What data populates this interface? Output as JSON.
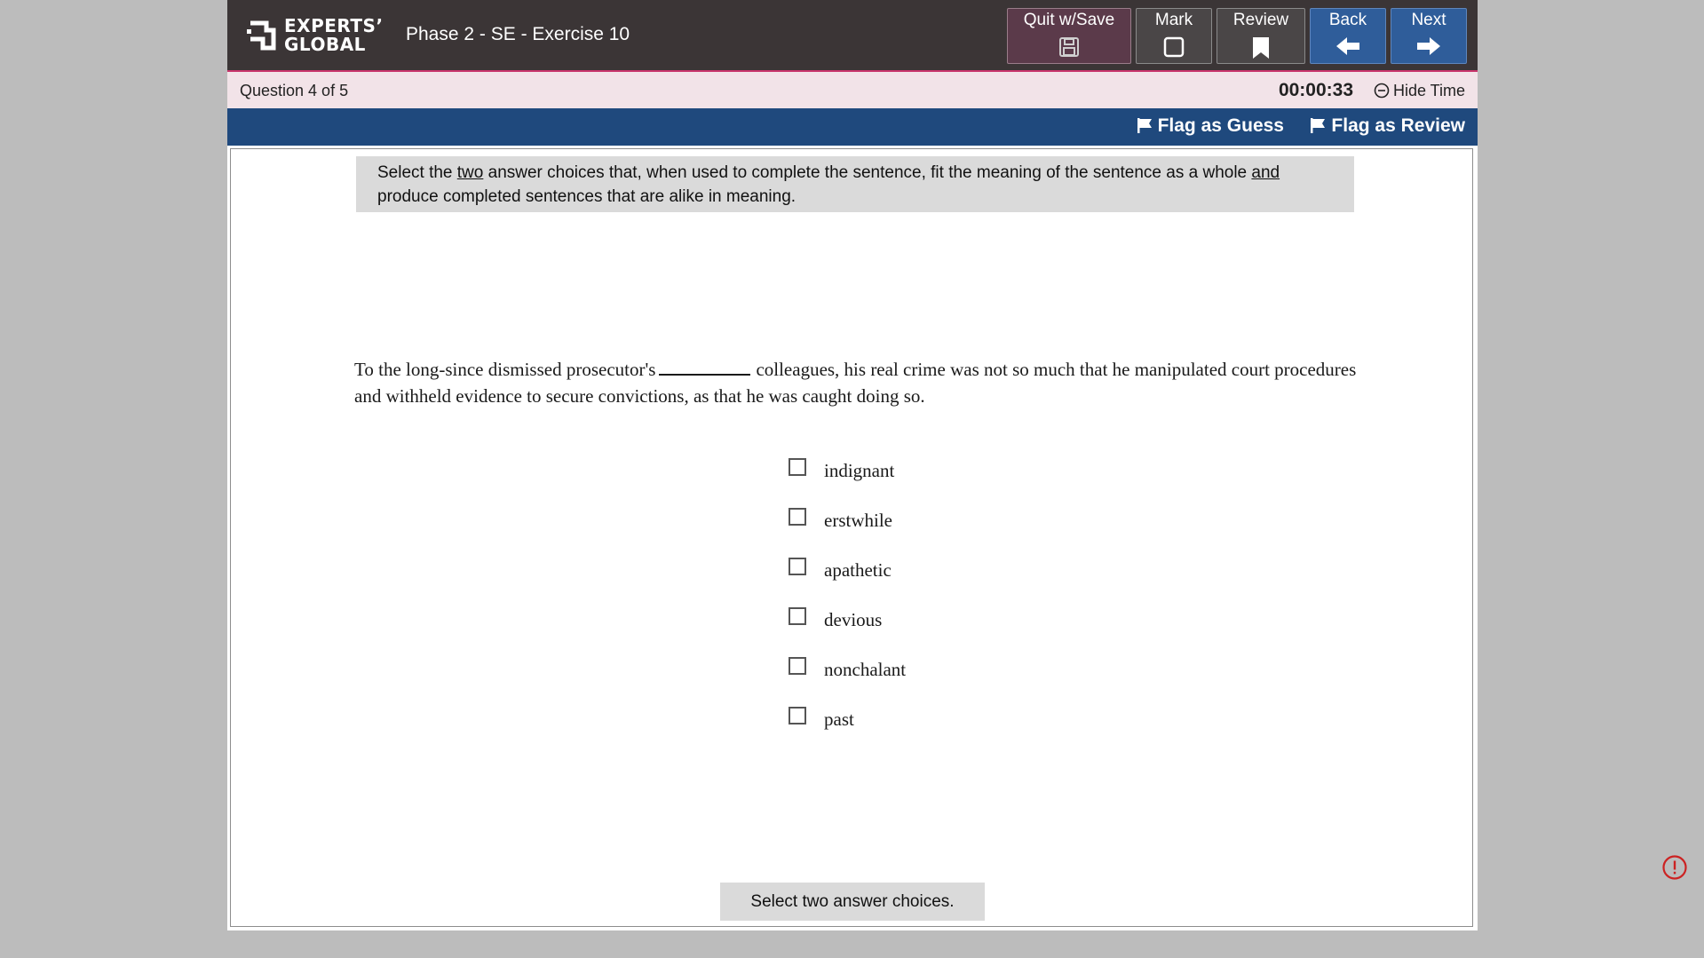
{
  "header": {
    "logo_line1": "EXPERTS’",
    "logo_line2": "GLOBAL",
    "exam_title": "Phase 2 - SE - Exercise 10",
    "buttons": {
      "quit_save": "Quit w/Save",
      "mark": "Mark",
      "review": "Review",
      "back": "Back",
      "next": "Next"
    }
  },
  "status": {
    "question_counter": "Question 4 of 5",
    "timer": "00:00:33",
    "hide_time": "Hide Time"
  },
  "flags": {
    "guess": "Flag as Guess",
    "review": "Flag as Review"
  },
  "instruction": {
    "part1": "Select the ",
    "u1": "two",
    "part2": " answer choices that, when used to complete the sentence, fit the meaning of the sentence as a whole ",
    "u2": "and",
    "part3": " produce completed sentences that are alike in meaning."
  },
  "question": {
    "before_blank": "To the long-since dismissed prosecutor's",
    "after_blank": "colleagues, his real crime was not so much that he manipulated court procedures and withheld evidence to secure convictions, as that he was caught doing so."
  },
  "choices": [
    "indignant",
    "erstwhile",
    "apathetic",
    "devious",
    "nonchalant",
    "past"
  ],
  "footer_message": "Select two answer choices.",
  "colors": {
    "header_bg": "#3b3536",
    "accent_pink": "#c9356c",
    "status_bg": "#f2e3e8",
    "flag_bar_bg": "#1f497d",
    "nav_blue": "#2f5d9a",
    "alert_red": "#cc2222"
  }
}
